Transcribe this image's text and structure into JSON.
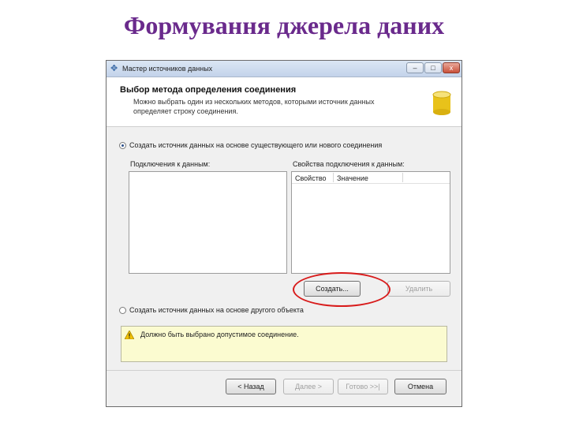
{
  "slide": {
    "title": "Формування джерела даних"
  },
  "window": {
    "title": "Мастер источников данных",
    "controls": {
      "minimize": "–",
      "maximize": "□",
      "close": "x"
    }
  },
  "header": {
    "title": "Выбор метода определения соединения",
    "description": "Можно выбрать один из нескольких методов, которыми источник данных определяет строку соединения."
  },
  "options": {
    "option1": "Создать источник данных на основе существующего или нового соединения",
    "option1_checked": true,
    "option2": "Создать источник данных на основе другого объекта",
    "option2_checked": false
  },
  "connections": {
    "label": "Подключения к данным:"
  },
  "properties": {
    "label": "Свойства подключения к данным:",
    "col_property": "Свойство",
    "col_value": "Значение"
  },
  "buttons": {
    "create": "Создать...",
    "delete": "Удалить",
    "back": "< Назад",
    "next": "Далее >",
    "finish": "Готово >>|",
    "cancel": "Отмена"
  },
  "warning": {
    "text": "Должно быть выбрано допустимое соединение."
  },
  "colors": {
    "slide_title": "#6a2a8c",
    "highlight": "#d81b1b",
    "warning_bg": "#fbfbd0"
  },
  "icons": {
    "window": "wizard-icon",
    "header": "database-icon",
    "warning": "warning-icon"
  }
}
